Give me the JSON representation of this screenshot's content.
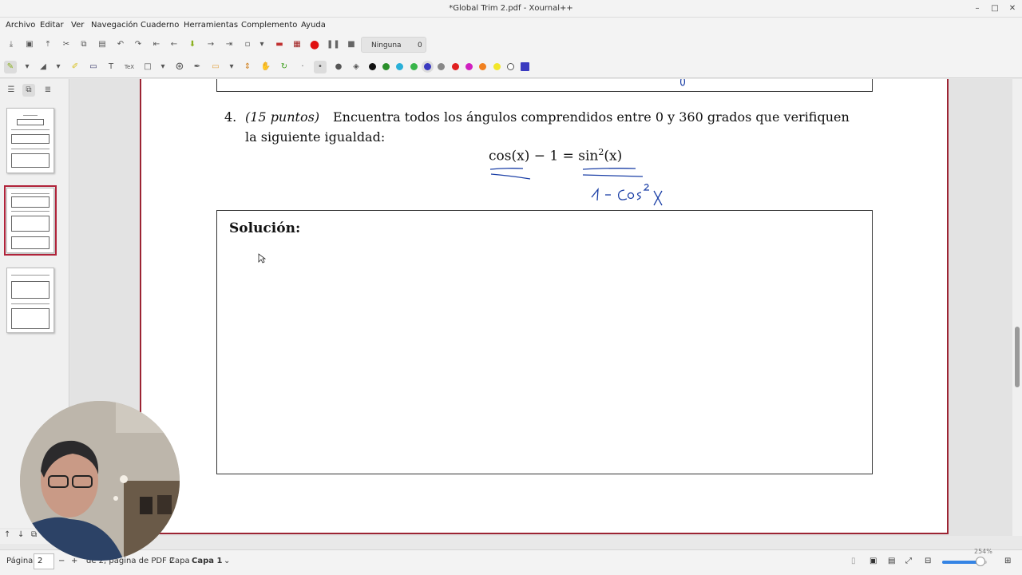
{
  "window": {
    "title": "*Global Trim 2.pdf - Xournal++"
  },
  "menu": [
    "Archivo",
    "Editar",
    "Ver",
    "Navegación",
    "Cuaderno",
    "Herramientas",
    "Complemento",
    "Ayuda"
  ],
  "toolbar": {
    "layer_select": "Ninguna",
    "layer_count": "0"
  },
  "colors": {
    "accent": "#b0233a",
    "black": "#111111",
    "green_dark": "#2a8f2a",
    "green": "#39b54a",
    "cyan": "#2ab0d8",
    "blue": "#3a3ac0",
    "gray": "#888888",
    "red": "#e02020",
    "magenta": "#d020c0",
    "orange": "#f08020",
    "yellow": "#f2e62a",
    "white": "#ffffff",
    "highlight": "#fbf78a",
    "ink": "#1b3fa6"
  },
  "document": {
    "question_number": "4.",
    "question_points": "(15 puntos)",
    "question_line1": "Encuentra todos los ángulos comprendidos entre 0 y 360 grados que verifiquen",
    "question_line2": "la siguiente igualdad:",
    "equation_left": "cos(x) − 1 = ",
    "equation_right_sin": "sin",
    "equation_right_exp": "2",
    "equation_right_arg": "(x)",
    "solution_label": "Solución:",
    "handwriting_note": "1 - cos² x"
  },
  "statusbar": {
    "page_label": "Página",
    "page_value": "2",
    "pdf_page_text": "de 2, página de PDF 2",
    "layer_label": "Capa",
    "layer_value": "Capa 1",
    "zoom_text": "254%",
    "zoom_fraction": 0.85
  }
}
